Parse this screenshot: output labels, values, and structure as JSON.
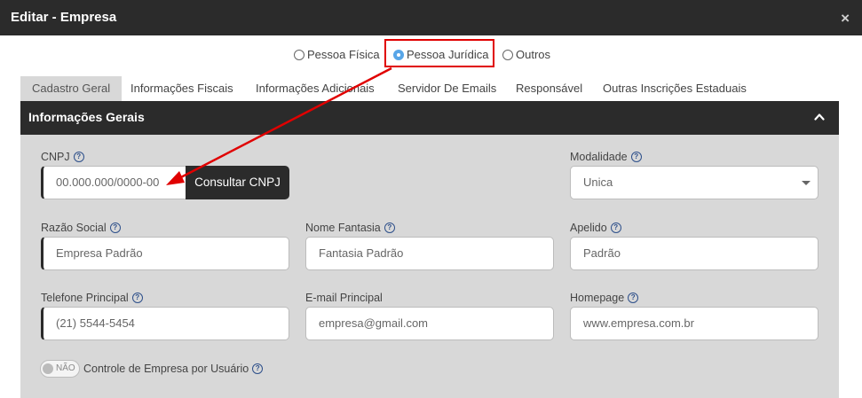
{
  "window": {
    "title": "Editar - Empresa",
    "close_glyph": "×"
  },
  "person_type": {
    "options": [
      {
        "label": "Pessoa Física",
        "checked": false
      },
      {
        "label": "Pessoa Jurídica",
        "checked": true
      },
      {
        "label": "Outros",
        "checked": false
      }
    ]
  },
  "tabs": [
    {
      "label": "Cadastro Geral",
      "active": true
    },
    {
      "label": "Informações Fiscais",
      "active": false
    },
    {
      "label": "Informações Adicionais",
      "active": false
    },
    {
      "label": "Servidor De Emails",
      "active": false
    },
    {
      "label": "Responsável",
      "active": false
    },
    {
      "label": "Outras Inscrições Estaduais",
      "active": false
    }
  ],
  "section": {
    "title": "Informações Gerais",
    "collapse_icon": "chevron-up-icon"
  },
  "form": {
    "cnpj": {
      "label": "CNPJ",
      "placeholder": "00.000.000/0000-00",
      "button": "Consultar CNPJ"
    },
    "modalidade": {
      "label": "Modalidade",
      "value": "Unica"
    },
    "razao_social": {
      "label": "Razão Social",
      "placeholder": "Empresa Padrão"
    },
    "nome_fantasia": {
      "label": "Nome Fantasia",
      "placeholder": "Fantasia Padrão"
    },
    "apelido": {
      "label": "Apelido",
      "placeholder": "Padrão"
    },
    "telefone": {
      "label": "Telefone Principal",
      "placeholder": "(21) 5544-5454"
    },
    "email": {
      "label": "E-mail Principal",
      "placeholder": "empresa@gmail.com"
    },
    "homepage": {
      "label": "Homepage",
      "placeholder": "www.empresa.com.br"
    },
    "controle": {
      "toggle_text": "NÃO",
      "label": "Controle de Empresa por Usuário"
    }
  },
  "help_glyph": "?",
  "colors": {
    "dark_bar": "#2b2b2b",
    "panel_bg": "#d8d8d8",
    "highlight": "#e00000",
    "radio_checked": "#58a6e8",
    "help_icon": "#2d4f8a"
  }
}
